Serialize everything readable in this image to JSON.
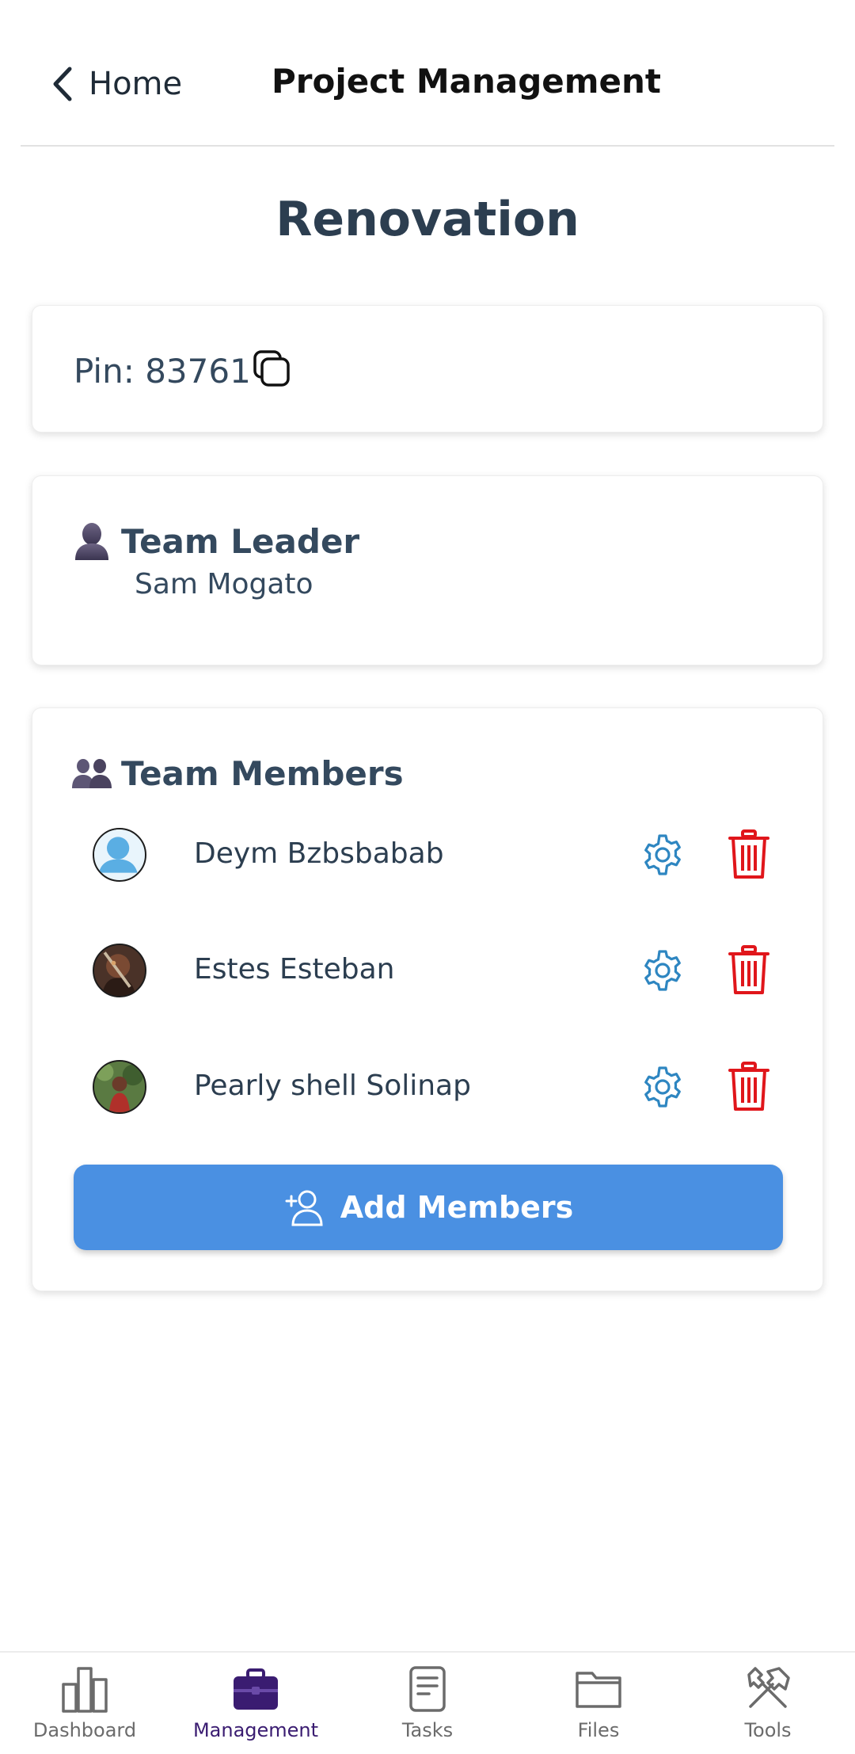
{
  "header": {
    "back_label": "Home",
    "title": "Project Management"
  },
  "project": {
    "name": "Renovation",
    "pin_label": "Pin: 83761"
  },
  "leader": {
    "heading": "Team Leader",
    "name": "Sam Mogato"
  },
  "members": {
    "heading": "Team Members",
    "items": [
      {
        "name": "Deym Bzbsbabab"
      },
      {
        "name": "Estes Esteban"
      },
      {
        "name": "Pearly shell Solinap"
      }
    ],
    "add_label": "Add Members"
  },
  "nav": {
    "items": [
      {
        "label": "Dashboard",
        "icon": "bar-chart-icon"
      },
      {
        "label": "Management",
        "icon": "briefcase-icon",
        "active": true
      },
      {
        "label": "Tasks",
        "icon": "document-icon"
      },
      {
        "label": "Files",
        "icon": "folder-icon"
      },
      {
        "label": "Tools",
        "icon": "tools-icon"
      }
    ]
  },
  "colors": {
    "primary_button": "#4a90e2",
    "gear": "#2e86c1",
    "trash": "#e0161b",
    "active_nav": "#3a1c71",
    "heading_text": "#2c3e50"
  }
}
